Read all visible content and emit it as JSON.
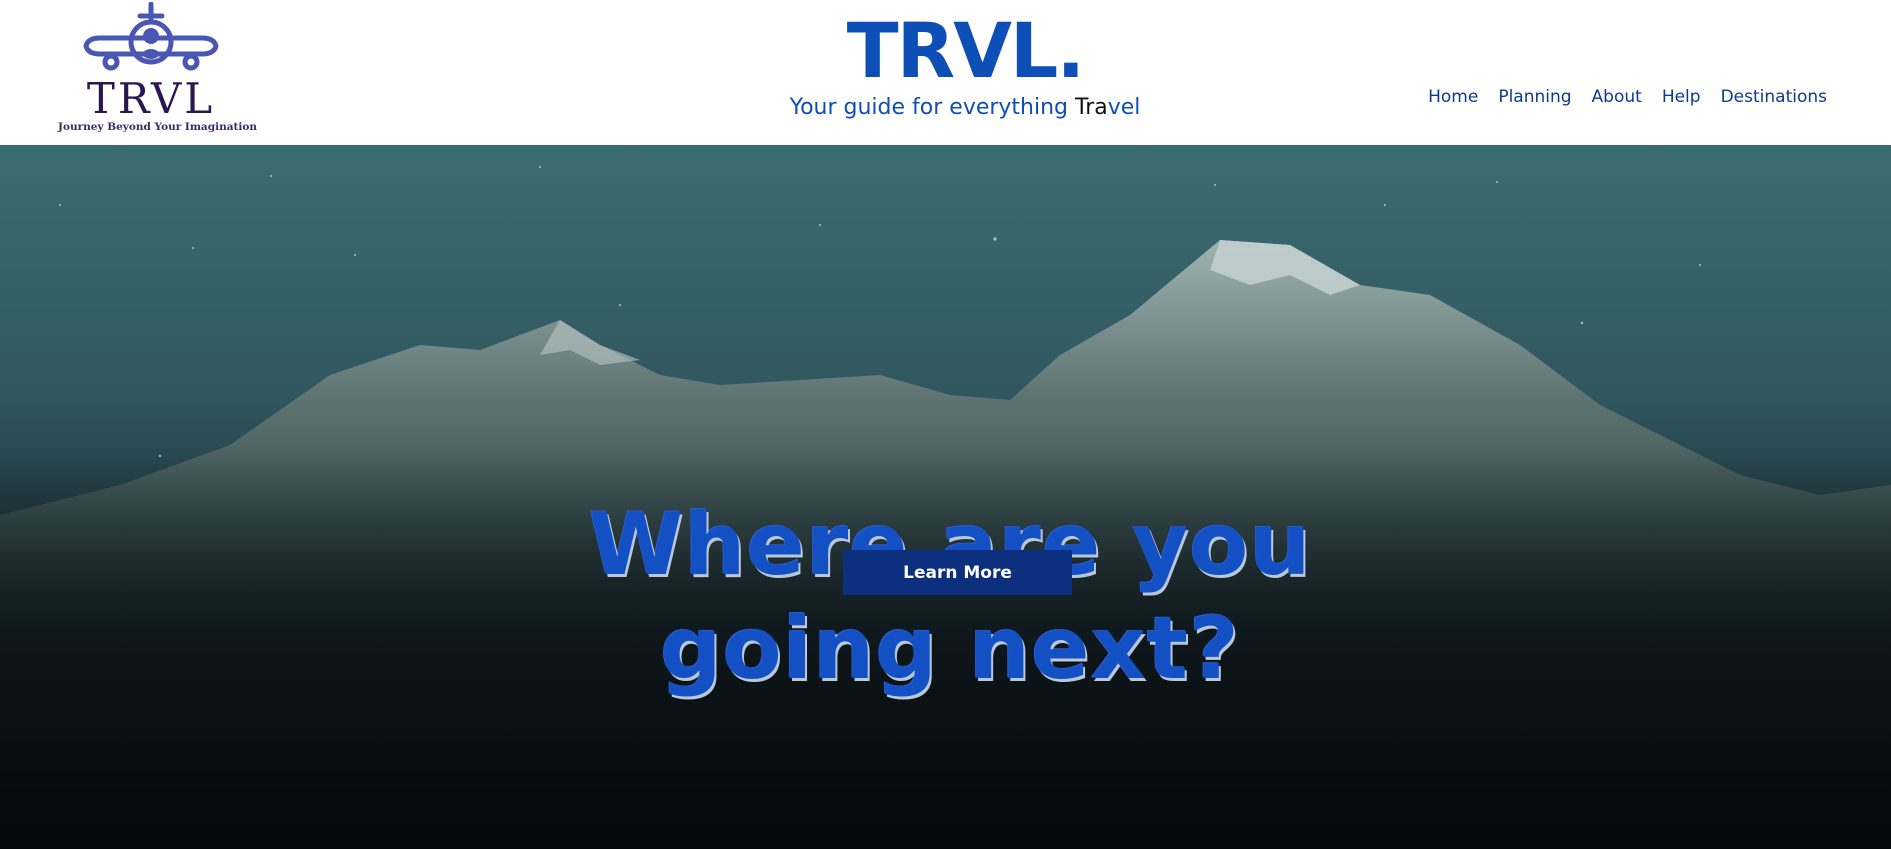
{
  "logo": {
    "icon": "airplane-icon",
    "wordmark": "TRVL",
    "tagline": "Journey Beyond Your Imagination",
    "color": "#4a56b3"
  },
  "brand": {
    "title": "TRVL.",
    "subtitle_blue": "Your guide for everything ",
    "subtitle_dark": "Tra",
    "subtitle_end": "vel"
  },
  "nav": {
    "items": [
      "Home",
      "Planning",
      "About",
      "Help",
      "Destinations"
    ]
  },
  "hero": {
    "headline_line1": "Where are you",
    "headline_line2": "going next?",
    "cta_label": "Learn More"
  },
  "colors": {
    "accent": "#0e4fb7",
    "nav": "#0e3a8e",
    "button": "#0c2f7e"
  }
}
